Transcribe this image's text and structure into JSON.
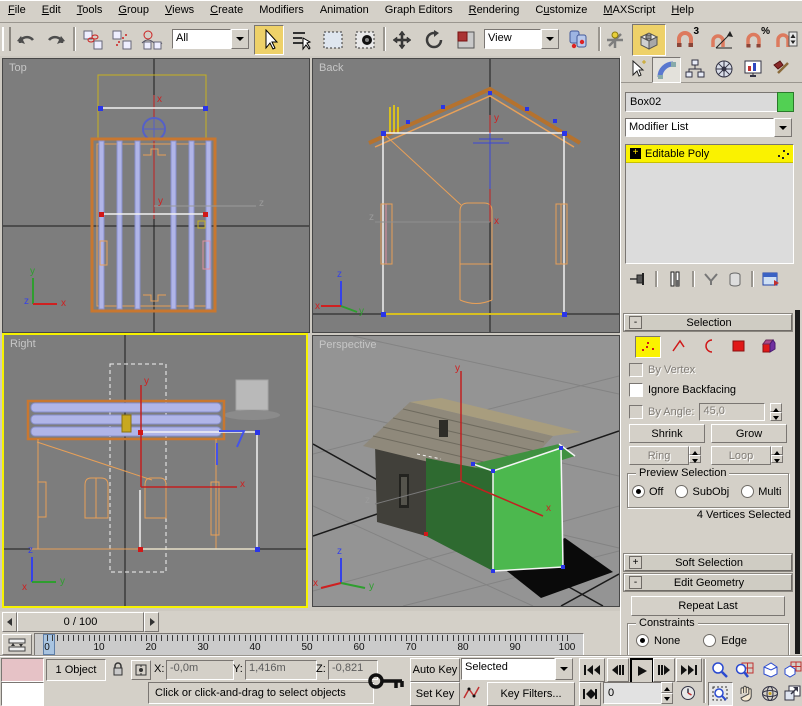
{
  "menu": {
    "items": [
      {
        "label": "File",
        "accel": 0
      },
      {
        "label": "Edit",
        "accel": 0
      },
      {
        "label": "Tools",
        "accel": 0
      },
      {
        "label": "Group",
        "accel": 0
      },
      {
        "label": "Views",
        "accel": 0
      },
      {
        "label": "Create",
        "accel": 0
      },
      {
        "label": "Modifiers",
        "accel": -1
      },
      {
        "label": "Animation",
        "accel": -1
      },
      {
        "label": "Graph Editors",
        "accel": -1
      },
      {
        "label": "Rendering",
        "accel": 0
      },
      {
        "label": "Customize",
        "accel": 1
      },
      {
        "label": "MAXScript",
        "accel": 0
      },
      {
        "label": "Help",
        "accel": 0
      }
    ]
  },
  "toolbar": {
    "selection_filter": "All",
    "coord_system": "View",
    "snap3_label": "3",
    "snap_pct_label": "%"
  },
  "viewports": {
    "top": {
      "label": "Top"
    },
    "back": {
      "label": "Back"
    },
    "right": {
      "label": "Right"
    },
    "perspective": {
      "label": "Perspective"
    },
    "axis": {
      "x": "x",
      "y": "y",
      "z": "z"
    }
  },
  "timeline": {
    "time_display": "0 / 100",
    "ruler_labels": [
      "0",
      "10",
      "20",
      "30",
      "40",
      "50",
      "60",
      "70",
      "80",
      "90",
      "100"
    ]
  },
  "status": {
    "object_count": "1 Object",
    "x_label": "X:",
    "x_value": "-0,0m",
    "y_label": "Y:",
    "y_value": "1,416m",
    "z_label": "Z:",
    "z_value": "-0,821",
    "prompt": "Click or click-and-drag to select objects",
    "auto_key": "Auto Key",
    "set_key": "Set Key",
    "key_filter_scope": "Selected",
    "key_filters": "Key Filters...",
    "frame_value": "0"
  },
  "panel": {
    "object_name": "Box02",
    "object_color": "#52d053",
    "modifier_list_label": "Modifier List",
    "stack_items": [
      {
        "expand": "+",
        "label": "Editable Poly"
      }
    ],
    "selection": {
      "state": "-",
      "title": "Selection",
      "by_vertex": "By Vertex",
      "ignore_backfacing": "Ignore Backfacing",
      "by_angle": "By Angle:",
      "angle_value": "45,0",
      "shrink": "Shrink",
      "grow": "Grow",
      "ring": "Ring",
      "loop": "Loop",
      "preview_title": "Preview Selection",
      "preview_options": [
        "Off",
        "SubObj",
        "Multi"
      ],
      "status_text": "4 Vertices Selected"
    },
    "soft_selection": {
      "state": "+",
      "title": "Soft Selection"
    },
    "edit_geometry": {
      "state": "-",
      "title": "Edit Geometry",
      "repeat_last": "Repeat Last",
      "constraints_title": "Constraints",
      "constraint_options": [
        "None",
        "Edge"
      ]
    }
  }
}
